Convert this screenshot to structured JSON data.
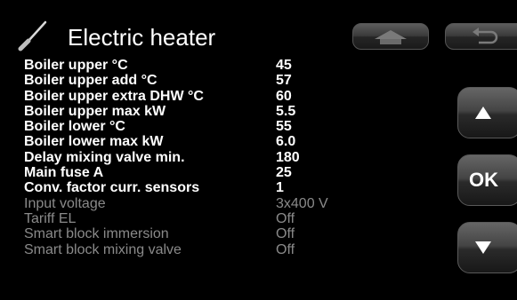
{
  "header": {
    "title": "Electric heater",
    "icon": "screwdriver-icon"
  },
  "nav": {
    "home_icon": "home-icon",
    "back_icon": "back-arrow-icon",
    "up_icon": "arrow-up-icon",
    "ok_label": "OK",
    "down_icon": "arrow-down-icon"
  },
  "params": [
    {
      "label": "Boiler upper °C",
      "value": "45",
      "enabled": true
    },
    {
      "label": "Boiler upper add °C",
      "value": "57",
      "enabled": true
    },
    {
      "label": "Boiler upper extra DHW °C",
      "value": "60",
      "enabled": true
    },
    {
      "label": "Boiler upper max kW",
      "value": "5.5",
      "enabled": true
    },
    {
      "label": "Boiler lower °C",
      "value": "55",
      "enabled": true
    },
    {
      "label": "Boiler lower max kW",
      "value": "6.0",
      "enabled": true
    },
    {
      "label": "Delay mixing valve min.",
      "value": "180",
      "enabled": true
    },
    {
      "label": "Main fuse A",
      "value": "25",
      "enabled": true
    },
    {
      "label": "Conv. factor curr. sensors",
      "value": "1",
      "enabled": true
    },
    {
      "label": "Input voltage",
      "value": "3x400 V",
      "enabled": false
    },
    {
      "label": "Tariff EL",
      "value": "Off",
      "enabled": false
    },
    {
      "label": "Smart block immersion",
      "value": "Off",
      "enabled": false
    },
    {
      "label": "Smart block mixing valve",
      "value": "Off",
      "enabled": false
    }
  ],
  "colors": {
    "background": "#000000",
    "active_text": "#ffffff",
    "inactive_text": "#8a8a8a"
  }
}
